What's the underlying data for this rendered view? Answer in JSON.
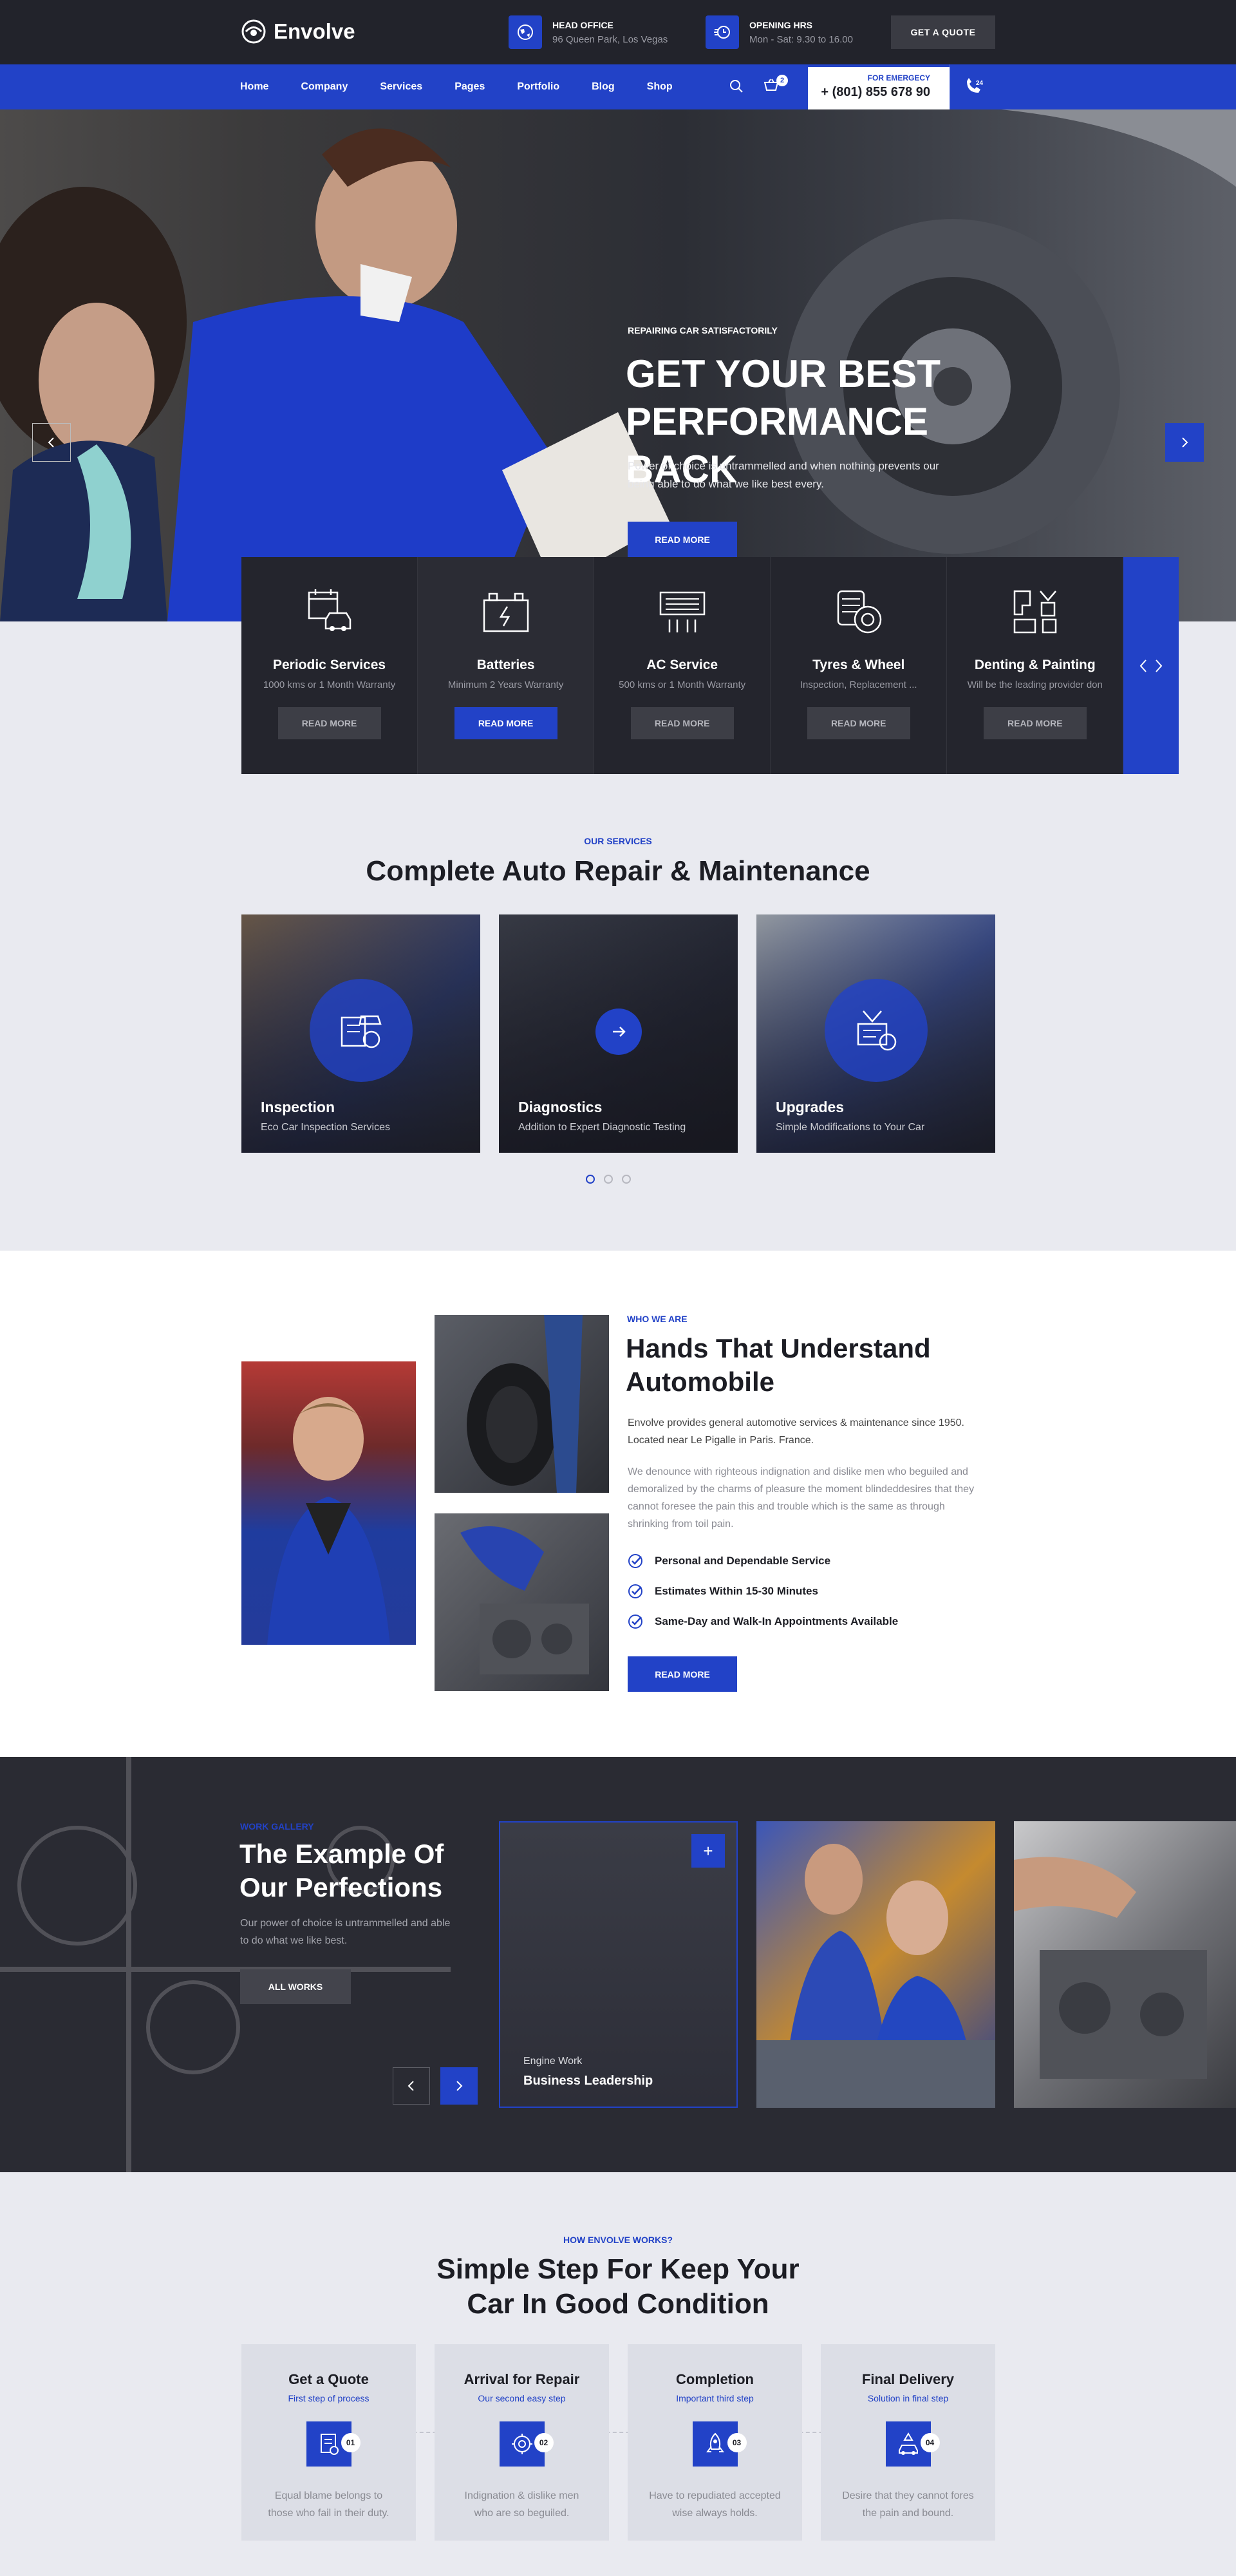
{
  "brand": {
    "name": "Envolve"
  },
  "topbar": {
    "head_office_label": "HEAD OFFICE",
    "head_office_value": "96 Queen Park, Los Vegas",
    "hours_label": "OPENING HRS",
    "hours_value": "Mon - Sat: 9.30 to 16.00",
    "quote_button": "GET A QUOTE"
  },
  "nav": {
    "items": [
      "Home",
      "Company",
      "Services",
      "Pages",
      "Portfolio",
      "Blog",
      "Shop"
    ],
    "cart_count": "2",
    "emergency_label": "FOR EMERGECY",
    "emergency_phone": "+ (801) 855 678 90"
  },
  "hero": {
    "eyebrow": "REPAIRING CAR SATISFACTORILY",
    "title": "GET YOUR BEST PERFORMANCE BACK",
    "text": "Power of choice is untrammelled and when nothing prevents our being able to do what we like best every.",
    "button": "READ MORE"
  },
  "service_strip": [
    {
      "title": "Periodic Services",
      "subtitle": "1000 kms or 1 Month Warranty",
      "button": "READ MORE",
      "icon": "calendar-car-icon"
    },
    {
      "title": "Batteries",
      "subtitle": "Minimum 2 Years Warranty",
      "button": "READ MORE",
      "icon": "battery-icon"
    },
    {
      "title": "AC Service",
      "subtitle": "500 kms or 1 Month Warranty",
      "button": "READ MORE",
      "icon": "ac-unit-icon"
    },
    {
      "title": "Tyres & Wheel",
      "subtitle": "Inspection, Replacement ...",
      "button": "READ MORE",
      "icon": "tyre-icon"
    },
    {
      "title": "Denting & Painting",
      "subtitle": "Will be the leading provider don",
      "button": "READ MORE",
      "icon": "spray-gun-icon"
    }
  ],
  "services": {
    "eyebrow": "OUR SERVICES",
    "title": "Complete Auto Repair & Maintenance",
    "cards": [
      {
        "title": "Inspection",
        "subtitle": "Eco Car Inspection Services"
      },
      {
        "title": "Diagnostics",
        "subtitle": "Addition to Expert Diagnostic Testing"
      },
      {
        "title": "Upgrades",
        "subtitle": "Simple Modifications to Your Car"
      }
    ]
  },
  "about": {
    "eyebrow": "WHO WE ARE",
    "title": "Hands That Understand Automobile",
    "p1": "Envolve provides general automotive services & maintenance since 1950. Located near Le Pigalle in Paris. France.",
    "p2": "We denounce with righteous indignation and dislike men who  beguiled and demoralized by the charms of pleasure the moment blindeddesires that they cannot foresee the pain this and trouble which is the same as through shrinking from toil pain.",
    "checks": [
      "Personal and Dependable Service",
      "Estimates Within  15-30 Minutes",
      "Same-Day and Walk-In Appointments Available"
    ],
    "button": "READ MORE"
  },
  "gallery": {
    "eyebrow": "WORK GALLERY",
    "title": "The Example Of Our Perfections",
    "text": "Our power of choice is untrammelled and able to do what we like best.",
    "button": "ALL WORKS",
    "card": {
      "category": "Engine Work",
      "title": "Business Leadership",
      "plus": "+"
    }
  },
  "steps": {
    "eyebrow": "HOW ENVOLVE WORKS?",
    "title": "Simple Step For Keep Your Car In Good Condition",
    "items": [
      {
        "title": "Get a Quote",
        "subtitle": "First step of process",
        "num": "01",
        "text": "Equal blame belongs to those who fail in their duty."
      },
      {
        "title": "Arrival for Repair",
        "subtitle": "Our second easy step",
        "num": "02",
        "text": "Indignation & dislike men who are so beguiled."
      },
      {
        "title": "Completion",
        "subtitle": "Important third step",
        "num": "03",
        "text": "Have to repudiated accepted wise always holds."
      },
      {
        "title": "Final Delivery",
        "subtitle": "Solution in final step",
        "num": "04",
        "text": "Desire that they cannot fores the pain and bound."
      }
    ]
  },
  "colors": {
    "accent": "#2242c7",
    "dark": "#22232b",
    "light_bg": "#e9eaf0"
  }
}
